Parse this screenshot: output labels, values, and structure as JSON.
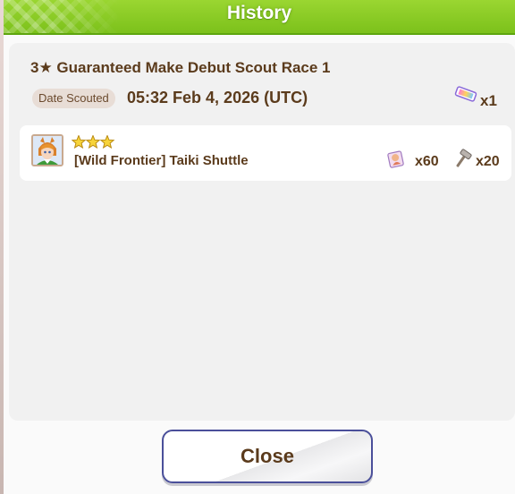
{
  "header": {
    "title": "History"
  },
  "entry": {
    "title": "3★ Guaranteed Make Debut Scout Race 1",
    "date_label": "Date Scouted",
    "date_value": "05:32 Feb 4, 2026 (UTC)",
    "cost_icon": "scout-ticket-icon",
    "cost_qty": "x1"
  },
  "results": [
    {
      "name": "[Wild Frontier] Taiki Shuttle",
      "stars": 3,
      "portrait_icon": "character-portrait",
      "rewards": [
        {
          "icon": "memory-piece-icon",
          "qty": "x60"
        },
        {
          "icon": "horseshoe-hammer-icon",
          "qty": "x20"
        }
      ]
    }
  ],
  "footer": {
    "close_label": "Close"
  },
  "colors": {
    "header_green": "#8ccf26",
    "text_brown": "#5b3b1c",
    "button_border": "#4a4f9a"
  }
}
